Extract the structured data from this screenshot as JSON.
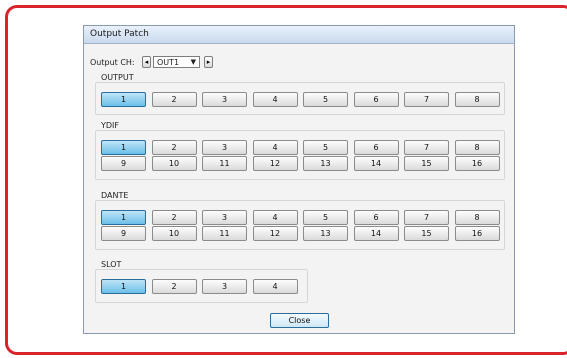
{
  "window": {
    "title": "Output Patch"
  },
  "output_ch": {
    "label": "Output CH:",
    "value": "OUT1",
    "left_arrow": "◂",
    "right_arrow": "▸",
    "dropdown_icon": "▼"
  },
  "groups": {
    "output": {
      "label": "OUTPUT",
      "selected": "1",
      "rows": [
        [
          "1",
          "2",
          "3",
          "4",
          "5",
          "6",
          "7",
          "8"
        ]
      ]
    },
    "ydif": {
      "label": "YDIF",
      "selected": "1",
      "rows": [
        [
          "1",
          "2",
          "3",
          "4",
          "5",
          "6",
          "7",
          "8"
        ],
        [
          "9",
          "10",
          "11",
          "12",
          "13",
          "14",
          "15",
          "16"
        ]
      ]
    },
    "dante": {
      "label": "DANTE",
      "selected": "1",
      "rows": [
        [
          "1",
          "2",
          "3",
          "4",
          "5",
          "6",
          "7",
          "8"
        ],
        [
          "9",
          "10",
          "11",
          "12",
          "13",
          "14",
          "15",
          "16"
        ]
      ]
    },
    "slot": {
      "label": "SLOT",
      "selected": "1",
      "rows": [
        [
          "1",
          "2",
          "3",
          "4"
        ]
      ]
    }
  },
  "close_label": "Close",
  "colors": {
    "frame": "#d9232d",
    "selected": "#6bbfe9"
  }
}
